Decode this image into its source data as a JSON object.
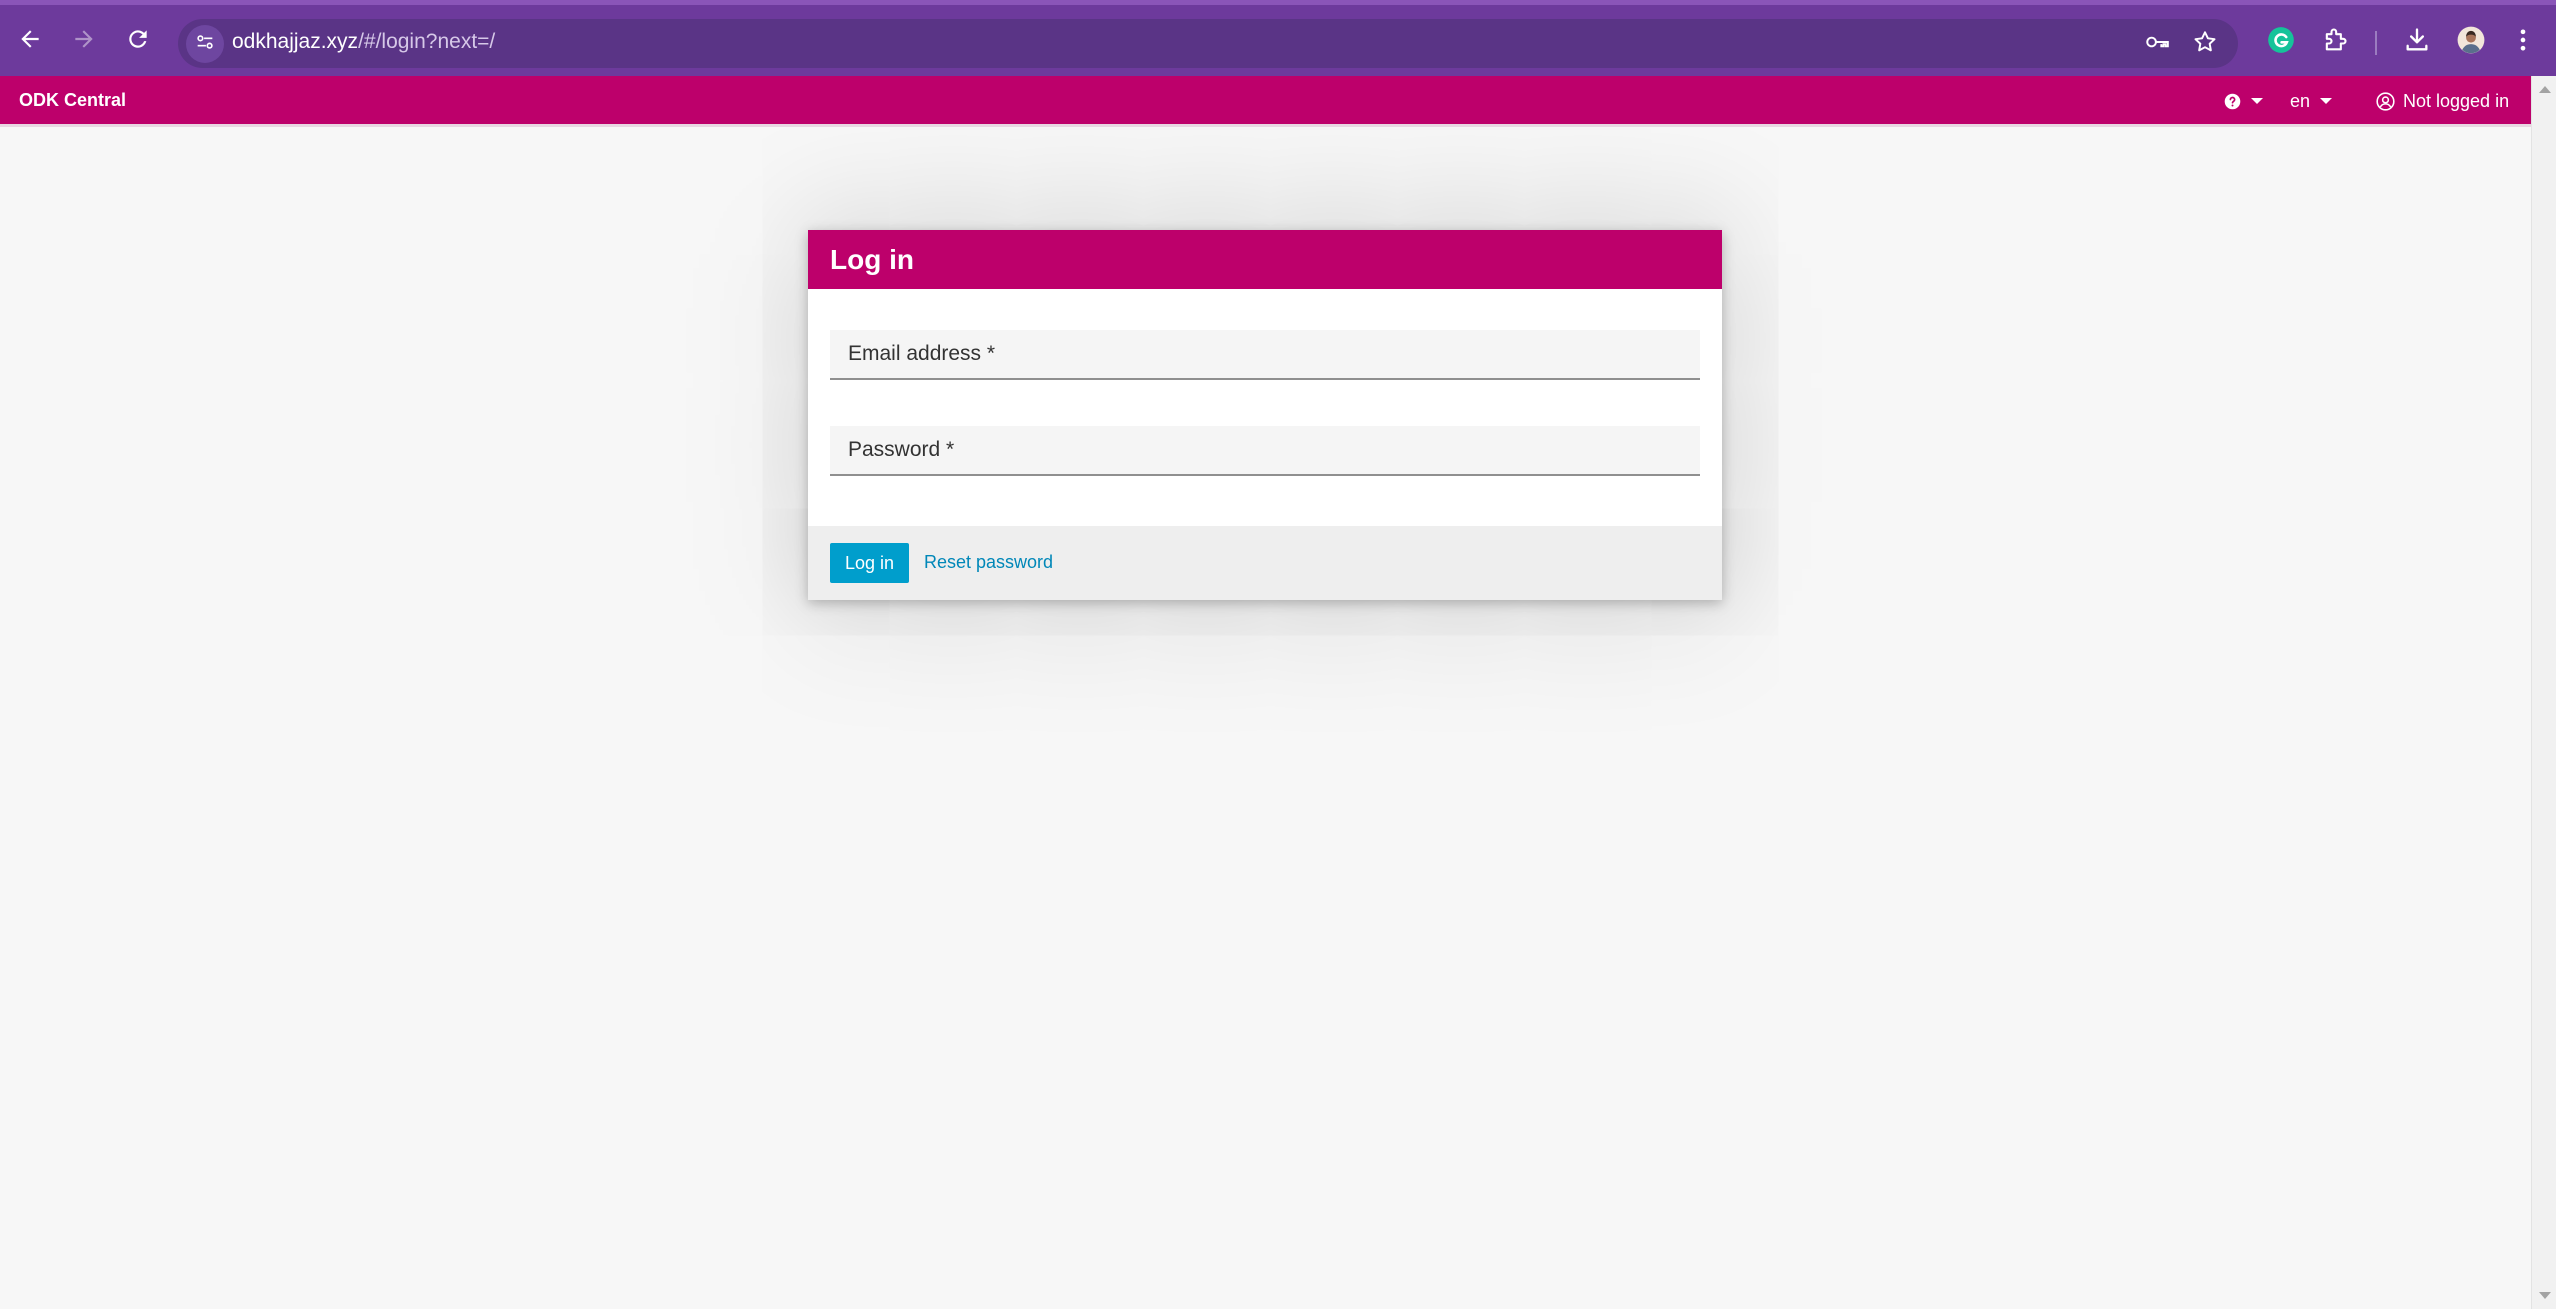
{
  "browser": {
    "url_host": "odkhajjaz.xyz",
    "url_path": "/#/login?next=/",
    "icons": {
      "back": "arrow-left-icon",
      "forward": "arrow-right-icon",
      "reload": "reload-icon",
      "site_info": "tune-icon",
      "password": "key-icon",
      "bookmark": "star-icon",
      "grammarly": "grammarly-icon",
      "extensions": "puzzle-icon",
      "downloads": "download-icon",
      "profile": "avatar",
      "menu": "kebab-menu-icon"
    },
    "colors": {
      "frame": "#6d3a9c",
      "omnibox": "#5a3486"
    }
  },
  "navbar": {
    "brand": "ODK Central",
    "help_icon": "question-circle-icon",
    "language": "en",
    "user_status": "Not logged in",
    "user_icon": "user-circle-icon",
    "color": "#bd006b"
  },
  "login": {
    "title": "Log in",
    "email_placeholder": "Email address *",
    "password_placeholder": "Password *",
    "submit_label": "Log in",
    "reset_link": "Reset password",
    "accent_color": "#009ecc"
  }
}
